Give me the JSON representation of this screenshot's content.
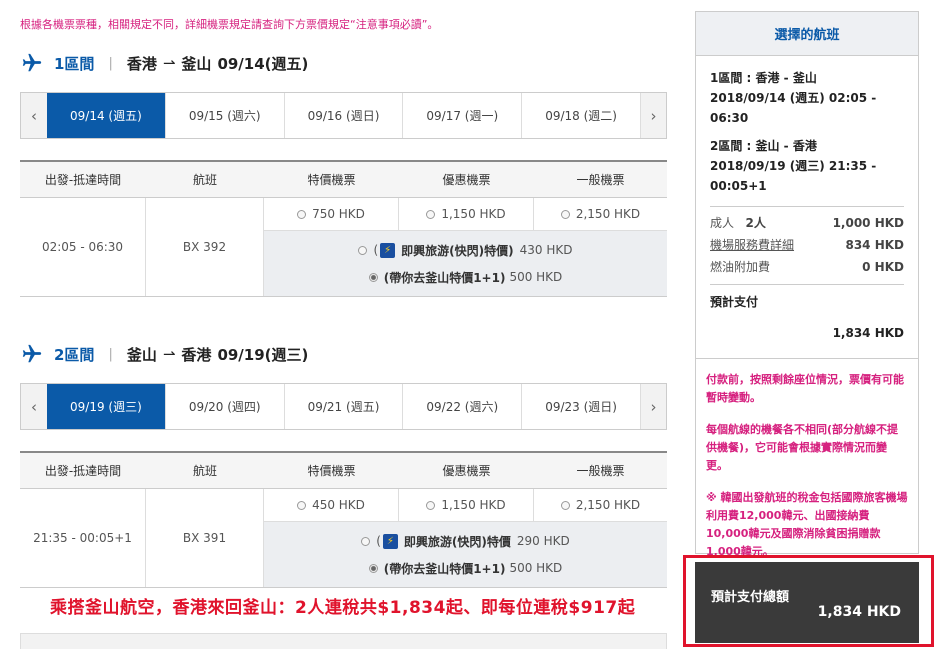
{
  "notice": "根據各機票票種，相關規定不同，詳細機票規定請查詢下方票價規定“注意事項必讀”。",
  "colors": {
    "brand": "#0b5aa8",
    "notice": "#d6217f",
    "promo": "#e0132c"
  },
  "legs": [
    {
      "icon": "plane-icon",
      "number": "1區間",
      "from": "香港",
      "to": "釜山",
      "date": "09/14(週五)",
      "dates": [
        "09/14 (週五)",
        "09/15 (週六)",
        "09/16 (週日)",
        "09/17 (週一)",
        "09/18 (週二)"
      ],
      "active_date": 0,
      "headers": [
        "出發-抵達時間",
        "航班",
        "特價機票",
        "優惠機票",
        "一般機票"
      ],
      "time": "02:05 - 06:30",
      "flight": "BX 392",
      "fares": [
        "750 HKD",
        "1,150 HKD",
        "2,150 HKD"
      ],
      "special1_prefix": "(",
      "special1_name": "即興旅游(快閃)特價)",
      "special1_price": "430 HKD",
      "special2_name": "(帶你去釜山特價1+1)",
      "special2_price": "500 HKD"
    },
    {
      "icon": "plane-icon",
      "number": "2區間",
      "from": "釜山",
      "to": "香港",
      "date": "09/19(週三)",
      "dates": [
        "09/19 (週三)",
        "09/20 (週四)",
        "09/21 (週五)",
        "09/22 (週六)",
        "09/23 (週日)"
      ],
      "active_date": 0,
      "headers": [
        "出發-抵達時間",
        "航班",
        "特價機票",
        "優惠機票",
        "一般機票"
      ],
      "time": "21:35 - 00:05+1",
      "flight": "BX 391",
      "fares": [
        "450 HKD",
        "1,150 HKD",
        "2,150 HKD"
      ],
      "special1_prefix": "(",
      "special1_name": "即興旅游(快閃)特價",
      "special1_price": "290 HKD",
      "special2_name": "(帶你去釜山特價1+1)",
      "special2_price": "500 HKD"
    }
  ],
  "promo": "乘搭釜山航空，香港來回釜山：2人連稅共$1,834起、即每位連稅$917起",
  "sidebar": {
    "title": "選擇的航班",
    "seg1_line1": "1區間 : 香港 - 釜山",
    "seg1_line2": "2018/09/14 (週五) 02:05 - 06:30",
    "seg2_line1": "2區間 : 釜山 - 香港",
    "seg2_line2": "2018/09/19 (週三) 21:35 -",
    "seg2_line3": "00:05+1",
    "adult_label": "成人",
    "adult_count": "2人",
    "adult_value": "1,000 HKD",
    "service_label": "機場服務費詳細",
    "service_value": "834 HKD",
    "fuel_label": "燃油附加費",
    "fuel_value": "0 HKD",
    "estimate_label": "預計支付",
    "estimate_value": "1,834 HKD",
    "note1": "付款前，按照剩餘座位情況，票價有可能暫時變動。",
    "note2": "每個航線的機餐各不相同(部分航線不提供機餐)，它可能會根據實際情況而變更。",
    "note3": "※ 韓國出發航班的稅金包括國際旅客機場利用費12,000韓元、出國接納費10,000韓元及國際消除貧困捐贈款1,000韓元。"
  },
  "total": {
    "label": "預計支付總額",
    "value": "1,834 HKD"
  }
}
